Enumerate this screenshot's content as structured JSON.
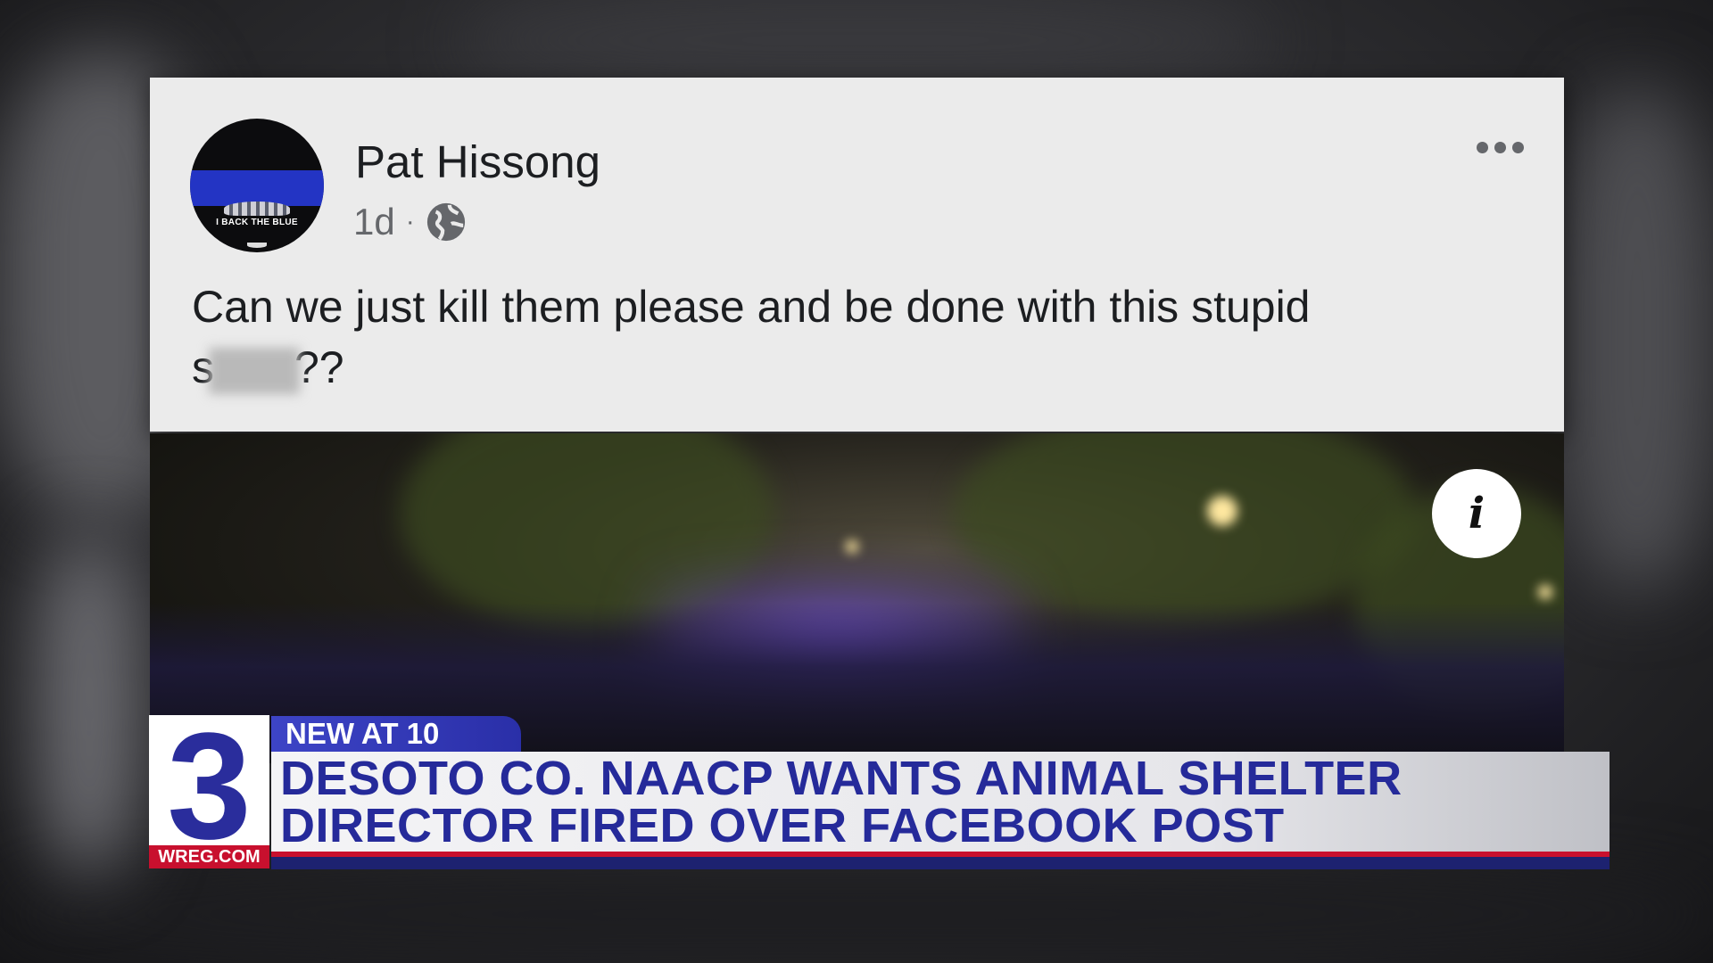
{
  "post": {
    "author": "Pat Hissong",
    "time": "1d",
    "separator": "·",
    "avatar_text": "I BACK THE BLUE",
    "text_line1": "Can we just kill them please and be done with this stupid",
    "text_line2_start": "s",
    "text_line2_end": "??"
  },
  "video": {
    "info_label": "i"
  },
  "lower_third": {
    "tag": "NEW AT 10",
    "headline_line1": "DESOTO CO. NAACP WANTS ANIMAL SHELTER",
    "headline_line2": "DIRECTOR FIRED OVER FACEBOOK POST",
    "logo_number": "3",
    "logo_site": "WREG.COM"
  },
  "colors": {
    "brand_blue": "#2a2d9c",
    "brand_red": "#c8102e",
    "facebook_gray": "#65676b"
  },
  "icons": [
    "globe-icon",
    "more-options-icon",
    "info-icon"
  ]
}
